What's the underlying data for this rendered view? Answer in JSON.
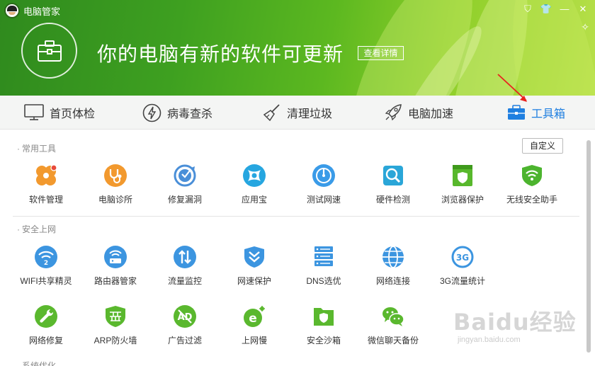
{
  "app": {
    "title": "电脑管家"
  },
  "window_controls": [
    {
      "icon": "shield-icon",
      "glyph": "⛉"
    },
    {
      "icon": "shirt-icon",
      "glyph": "👕"
    },
    {
      "icon": "minimize-icon",
      "glyph": "—"
    },
    {
      "icon": "close-icon",
      "glyph": "✕"
    }
  ],
  "header": {
    "headline": "你的电脑有新的软件可更新",
    "detail_button": "查看详情"
  },
  "nav": {
    "items": [
      {
        "label": "首页体检",
        "icon": "monitor-icon"
      },
      {
        "label": "病毒查杀",
        "icon": "lightning-icon"
      },
      {
        "label": "清理垃圾",
        "icon": "broom-icon"
      },
      {
        "label": "电脑加速",
        "icon": "rocket-icon"
      },
      {
        "label": "工具箱",
        "icon": "toolbox-icon",
        "active": true
      }
    ]
  },
  "sections": {
    "common": {
      "title": "常用工具",
      "custom_button": "自定义",
      "tools": [
        {
          "label": "软件管理",
          "icon": "software-manager-icon",
          "color": "#f2992e"
        },
        {
          "label": "电脑诊所",
          "icon": "clinic-stethoscope-icon",
          "color": "#f2992e"
        },
        {
          "label": "修复漏洞",
          "icon": "vulnerability-repair-icon",
          "color": "#4a8fd8"
        },
        {
          "label": "应用宝",
          "icon": "app-store-icon",
          "color": "#26a6e0"
        },
        {
          "label": "测试网速",
          "icon": "speed-test-icon",
          "color": "#3a9be8"
        },
        {
          "label": "硬件检测",
          "icon": "hardware-detect-icon",
          "color": "#2aa6d8"
        },
        {
          "label": "浏览器保护",
          "icon": "browser-protect-icon",
          "color": "#58b82c"
        },
        {
          "label": "无线安全助手",
          "icon": "wifi-security-icon",
          "color": "#4cb42e"
        }
      ]
    },
    "security": {
      "title": "安全上网",
      "tools": [
        {
          "label": "WIFI共享精灵",
          "icon": "wifi-share-icon",
          "color": "#3c95e0"
        },
        {
          "label": "路由器管家",
          "icon": "router-manager-icon",
          "color": "#3c95e0"
        },
        {
          "label": "流量监控",
          "icon": "traffic-monitor-icon",
          "color": "#3c95e0"
        },
        {
          "label": "网速保护",
          "icon": "speed-protect-icon",
          "color": "#3c95e0"
        },
        {
          "label": "DNS选优",
          "icon": "dns-select-icon",
          "color": "#3c95e0"
        },
        {
          "label": "网络连接",
          "icon": "network-connect-icon",
          "color": "#3c95e0"
        },
        {
          "label": "3G流量统计",
          "icon": "3g-traffic-icon",
          "color": "#3c95e0"
        },
        {
          "label": "网络修复",
          "icon": "network-repair-icon",
          "color": "#5ab82e"
        },
        {
          "label": "ARP防火墙",
          "icon": "arp-firewall-icon",
          "color": "#5ab82e"
        },
        {
          "label": "广告过滤",
          "icon": "ad-filter-icon",
          "color": "#5ab82e"
        },
        {
          "label": "上网慢",
          "icon": "slow-internet-icon",
          "color": "#5ab82e"
        },
        {
          "label": "安全沙箱",
          "icon": "sandbox-icon",
          "color": "#5ab82e"
        },
        {
          "label": "微信聊天备份",
          "icon": "wechat-backup-icon",
          "color": "#5ab82e"
        }
      ]
    },
    "system": {
      "title": "系统优化"
    }
  },
  "watermark": {
    "logo": "Baidu经验",
    "url": "jingyan.baidu.com"
  }
}
